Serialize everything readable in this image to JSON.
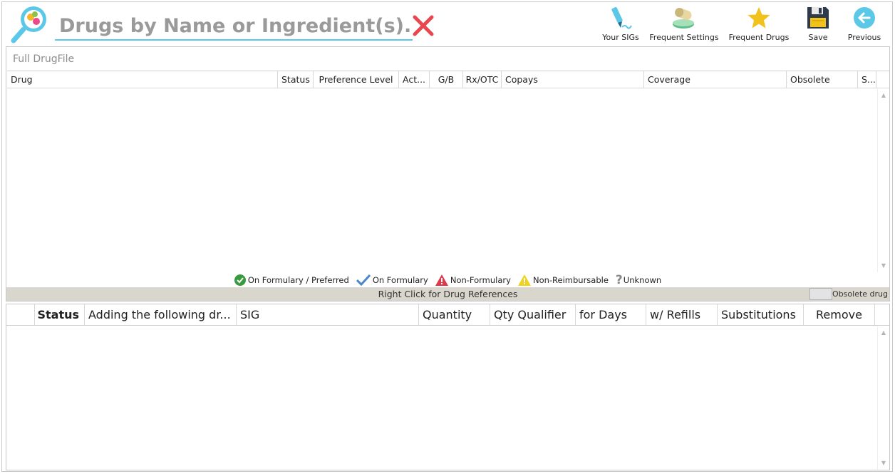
{
  "search": {
    "placeholder": "Drugs by Name or Ingredient(s)..."
  },
  "toolbar": {
    "your_sigs": "Your SIGs",
    "frequent_settings": "Frequent Settings",
    "frequent_drugs": "Frequent Drugs",
    "save": "Save",
    "previous": "Previous"
  },
  "drug_panel": {
    "title": "Full DrugFile",
    "columns": [
      "Drug",
      "Status",
      "Preference Level",
      "Act...",
      "G/B",
      "Rx/OTC",
      "Copays",
      "Coverage",
      "Obsolete",
      "S..."
    ]
  },
  "legend": {
    "on_formulary_preferred": "On Formulary / Preferred",
    "on_formulary": "On Formulary",
    "non_formulary": "Non-Formulary",
    "non_reimbursable": "Non-Reimbursable",
    "unknown": "Unknown"
  },
  "reference_bar": {
    "hint": "Right Click for Drug References",
    "obsolete_label": "Obsolete drug"
  },
  "order_panel": {
    "columns": [
      "",
      "Status",
      "Adding the following dr...",
      "SIG",
      "Quantity",
      "Qty Qualifier",
      "for Days",
      "w/ Refills",
      "Substitutions",
      "Remove"
    ]
  },
  "colors": {
    "accent": "#5bc8e8",
    "clear_red": "#e8474f",
    "preferred_green": "#3a9a3f",
    "formulary_blue": "#4a87c8",
    "nonformulary_red": "#e03a4a",
    "nonreimbursable_yellow": "#f0d21c",
    "reference_bar_bg": "#d9d6cd"
  },
  "icons": {
    "logo": "magnifier-pills-icon",
    "clear": "close-icon",
    "your_sigs": "pen-sig-icon",
    "frequent_settings": "pill-bottle-icon",
    "frequent_drugs": "star-icon",
    "save": "floppy-disk-icon",
    "previous": "back-arrow-icon"
  }
}
